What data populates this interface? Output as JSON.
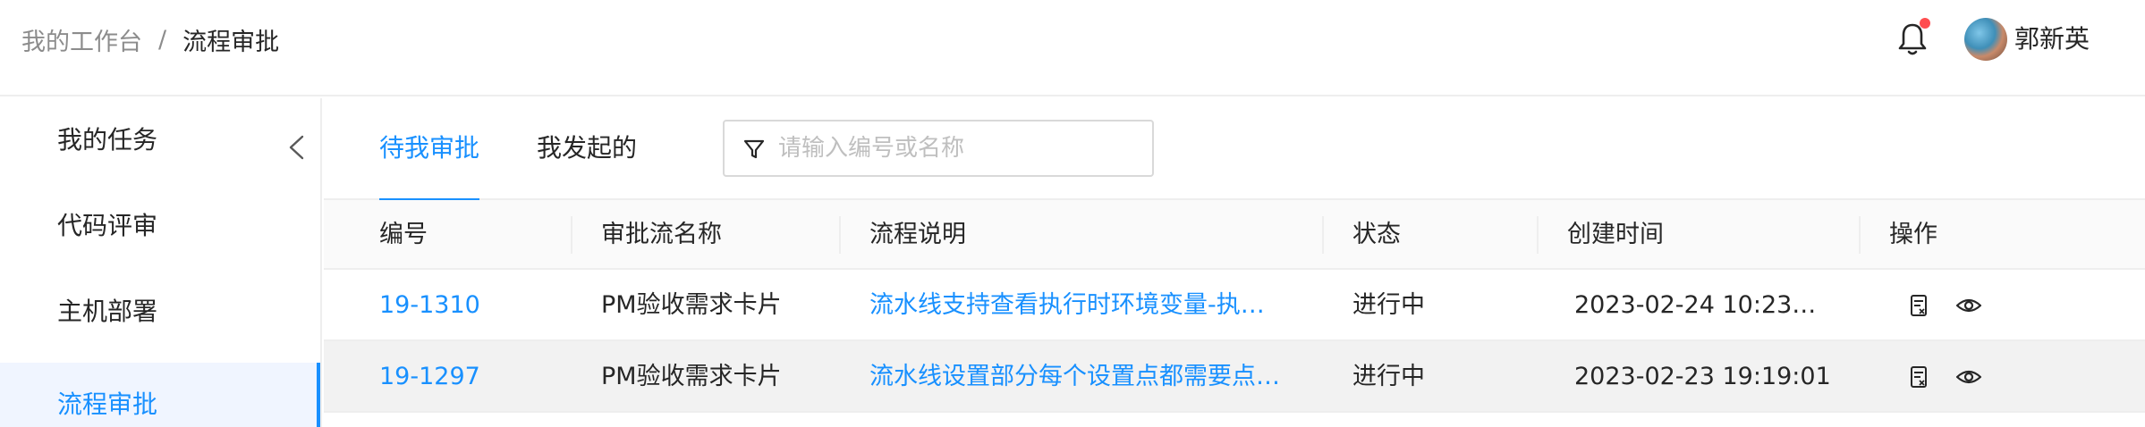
{
  "header": {
    "breadcrumb": {
      "parent": "我的工作台",
      "separator": "/",
      "current": "流程审批"
    },
    "user": {
      "name": "郭新英"
    }
  },
  "sidebar": {
    "items": [
      {
        "label": "我的任务"
      },
      {
        "label": "代码评审"
      },
      {
        "label": "主机部署"
      },
      {
        "label": "流程审批"
      }
    ],
    "active_index": 3
  },
  "tabs": [
    {
      "label": "待我审批"
    },
    {
      "label": "我发起的"
    }
  ],
  "filter": {
    "placeholder": "请输入编号或名称"
  },
  "table": {
    "columns": [
      "编号",
      "审批流名称",
      "流程说明",
      "状态",
      "创建时间",
      "操作"
    ],
    "rows": [
      {
        "id": "19-1310",
        "name": "PM验收需求卡片",
        "desc": "流水线支持查看执行时环境变量-执…",
        "status": "进行中",
        "created": "2023-02-24 10:23…"
      },
      {
        "id": "19-1297",
        "name": "PM验收需求卡片",
        "desc": "流水线设置部分每个设置点都需要点…",
        "status": "进行中",
        "created": "2023-02-23 19:19:01"
      }
    ]
  },
  "colors": {
    "accent": "#1890ff",
    "notification_dot": "#ff4d4f",
    "hover_row": "#f2f2f2"
  },
  "icons": [
    "bell-icon",
    "avatar",
    "collapse-left-icon",
    "filter-icon",
    "approve-doc-icon",
    "view-eye-icon"
  ]
}
